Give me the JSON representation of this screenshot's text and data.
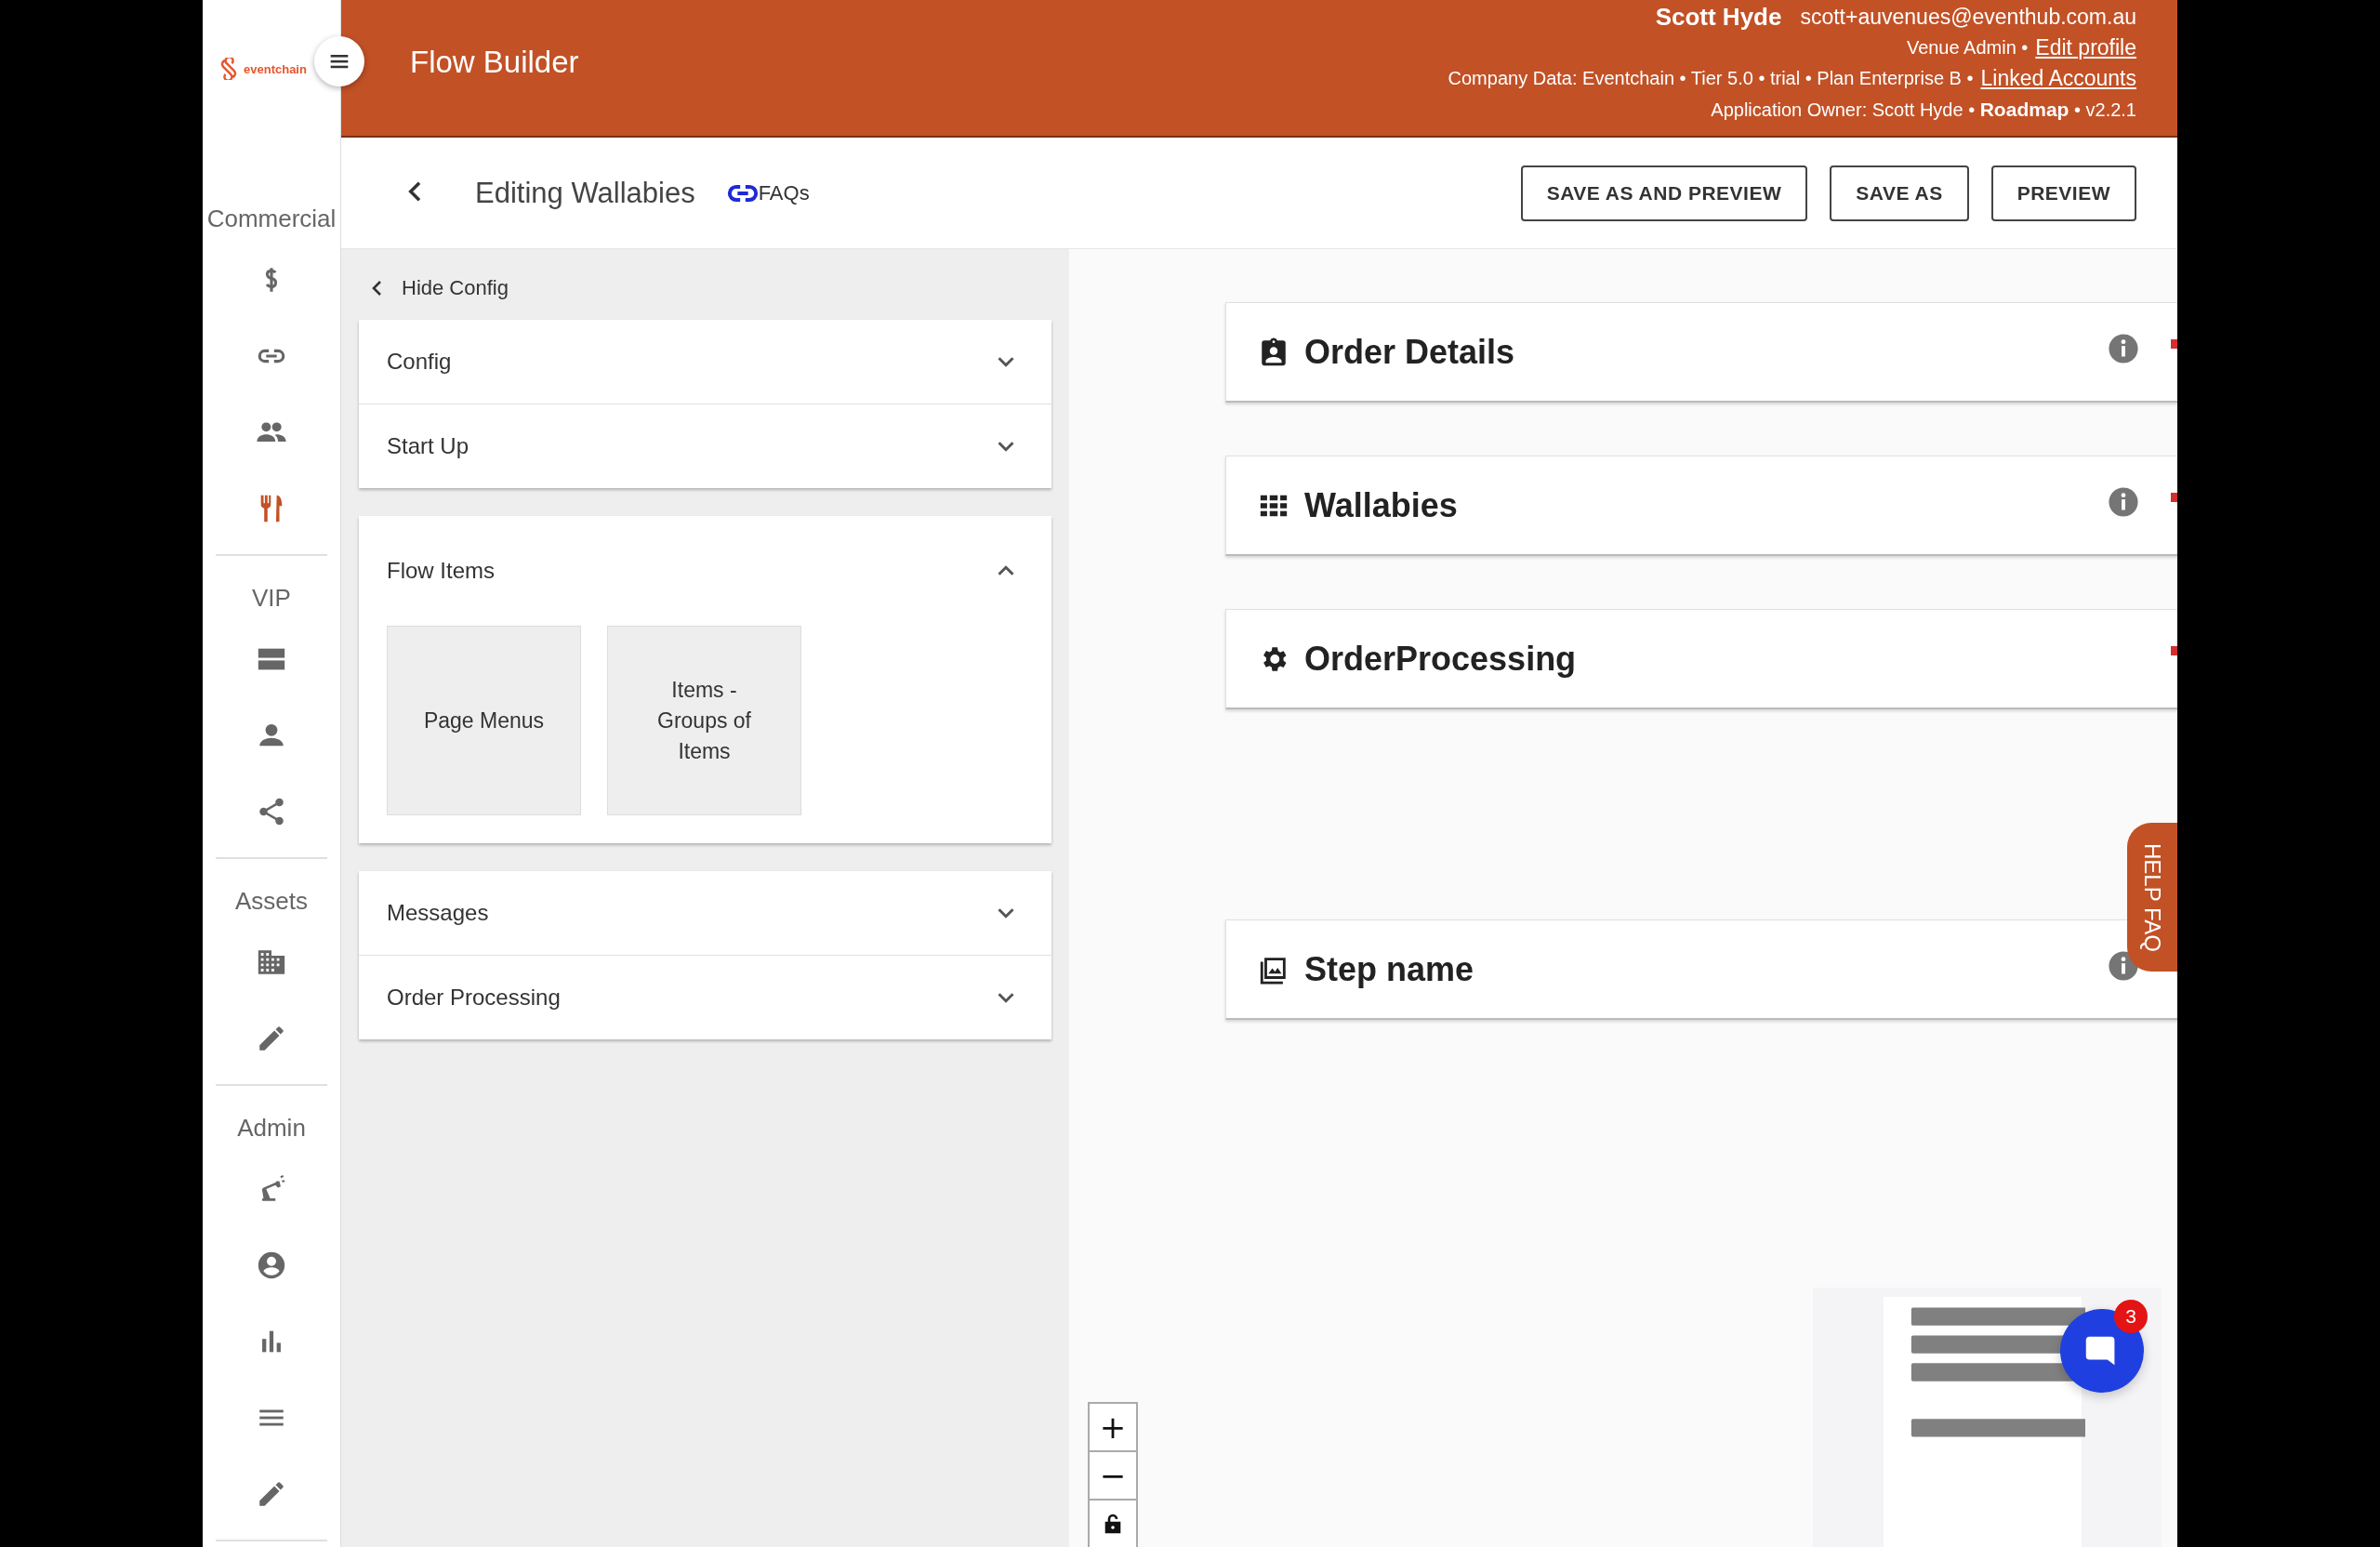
{
  "brand": {
    "logo_text": "eventchain"
  },
  "header": {
    "title": "Flow Builder",
    "user_name": "Scott Hyde",
    "email": "scott+auvenues@eventhub.com.au",
    "role_line": {
      "text": "Venue Admin •",
      "link": "Edit profile"
    },
    "company_line": {
      "text": "Company Data: Eventchain • Tier 5.0 • trial • Plan Enterprise B •",
      "link": "Linked Accounts"
    },
    "owner_line": "Application Owner: Scott Hyde • **Roadmap** • v2.2.1"
  },
  "sidebar": {
    "sections": [
      {
        "title": "Commercial",
        "items": [
          {
            "selected": false
          },
          {
            "selected": false
          },
          {
            "selected": false
          },
          {
            "selected": true
          }
        ]
      },
      {
        "title": "VIP",
        "items": [
          {
            "selected": false
          },
          {
            "selected": false
          },
          {
            "selected": false
          }
        ]
      },
      {
        "title": "Assets",
        "items": [
          {
            "selected": false
          },
          {
            "selected": false
          }
        ]
      },
      {
        "title": "Admin",
        "items": [
          {
            "selected": false
          },
          {
            "selected": false
          },
          {
            "selected": false
          },
          {
            "selected": false
          },
          {
            "selected": false
          }
        ]
      }
    ]
  },
  "toolbar": {
    "title": "Editing Wallabies",
    "faq_link": "FAQs",
    "buttons": [
      "SAVE AS AND PREVIEW",
      "SAVE AS",
      "PREVIEW"
    ]
  },
  "config_panel": {
    "hide_label": "Hide Config",
    "groups": [
      {
        "sections": [
          {
            "title": "Config",
            "expanded": false
          },
          {
            "title": "Start Up",
            "expanded": false
          }
        ]
      },
      {
        "sections": [
          {
            "title": "Flow Items",
            "expanded": true,
            "tiles": [
              "Page Menus",
              "Items - Groups of Items"
            ]
          }
        ]
      },
      {
        "sections": [
          {
            "title": "Messages",
            "expanded": false
          },
          {
            "title": "Order Processing",
            "expanded": false
          }
        ]
      }
    ]
  },
  "canvas": {
    "steps": [
      {
        "title": "Order Details",
        "has_info": true
      },
      {
        "title": "Wallabies",
        "has_info": true
      },
      {
        "title": "OrderProcessing",
        "has_info": false
      },
      {
        "title": "Step name",
        "has_info": true
      }
    ],
    "help_tab": "HELP FAQ",
    "zoom_controls": [
      "+",
      "−"
    ],
    "chat_badge": "3"
  }
}
